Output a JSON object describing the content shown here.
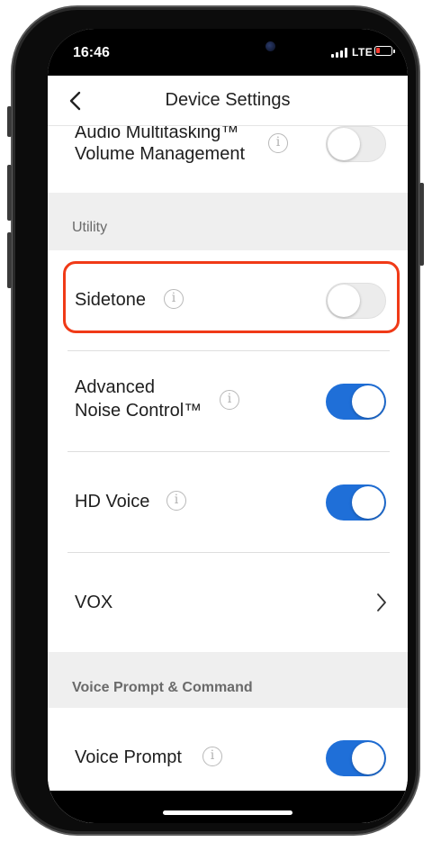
{
  "status": {
    "time": "16:46",
    "network": "LTE"
  },
  "nav": {
    "title": "Device Settings"
  },
  "rows": {
    "audio_multitasking": {
      "line1": "Audio Multitasking™",
      "line2": "Volume Management",
      "on": false
    },
    "sidetone": {
      "label": "Sidetone",
      "on": false
    },
    "advanced_noise": {
      "line1": "Advanced",
      "line2": "Noise Control™",
      "on": true
    },
    "hd_voice": {
      "label": "HD Voice",
      "on": true
    },
    "vox": {
      "label": "VOX"
    },
    "voice_prompt": {
      "label": "Voice Prompt",
      "on": true
    }
  },
  "sections": {
    "utility": "Utility",
    "voice_prompt_command": "Voice Prompt & Command"
  },
  "colors": {
    "toggle_on": "#1f6fd8",
    "highlight": "#f03a17"
  },
  "icons": [
    "back-chevron-icon",
    "info-icon",
    "chevron-right-icon",
    "signal-icon",
    "battery-icon"
  ]
}
